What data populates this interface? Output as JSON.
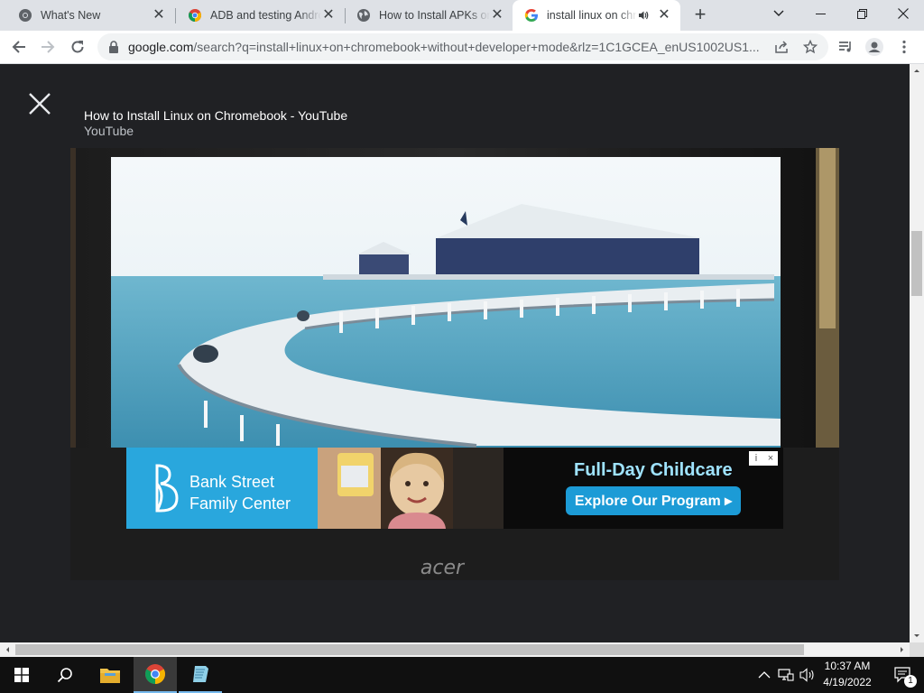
{
  "browser": {
    "tabs": [
      {
        "title": "What's New",
        "icon": "chrome-icon",
        "active": false
      },
      {
        "title": "ADB and testing Andro",
        "icon": "chrome-colored-icon",
        "active": false
      },
      {
        "title": "How to Install APKs on",
        "icon": "globe-icon",
        "active": false
      },
      {
        "title": "install linux on chr",
        "icon": "google-icon",
        "active": true,
        "audio": true
      }
    ],
    "url_host": "google.com",
    "url_rest": "/search?q=install+linux+on+chromebook+without+developer+mode&rlz=1C1GCEA_enUS1002US1..."
  },
  "overlay": {
    "title": "How to Install Linux on Chromebook - YouTube",
    "source": "YouTube"
  },
  "preview": {
    "laptop_brand": "acer"
  },
  "ad": {
    "brand_line1": "Bank Street",
    "brand_line2": "Family Center",
    "headline": "Full-Day Childcare",
    "cta": "Explore Our Program ▸",
    "choices_icon": "i",
    "close_icon": "×"
  },
  "taskbar": {
    "time": "10:37 AM",
    "date": "4/19/2022",
    "notification_count": "1"
  }
}
